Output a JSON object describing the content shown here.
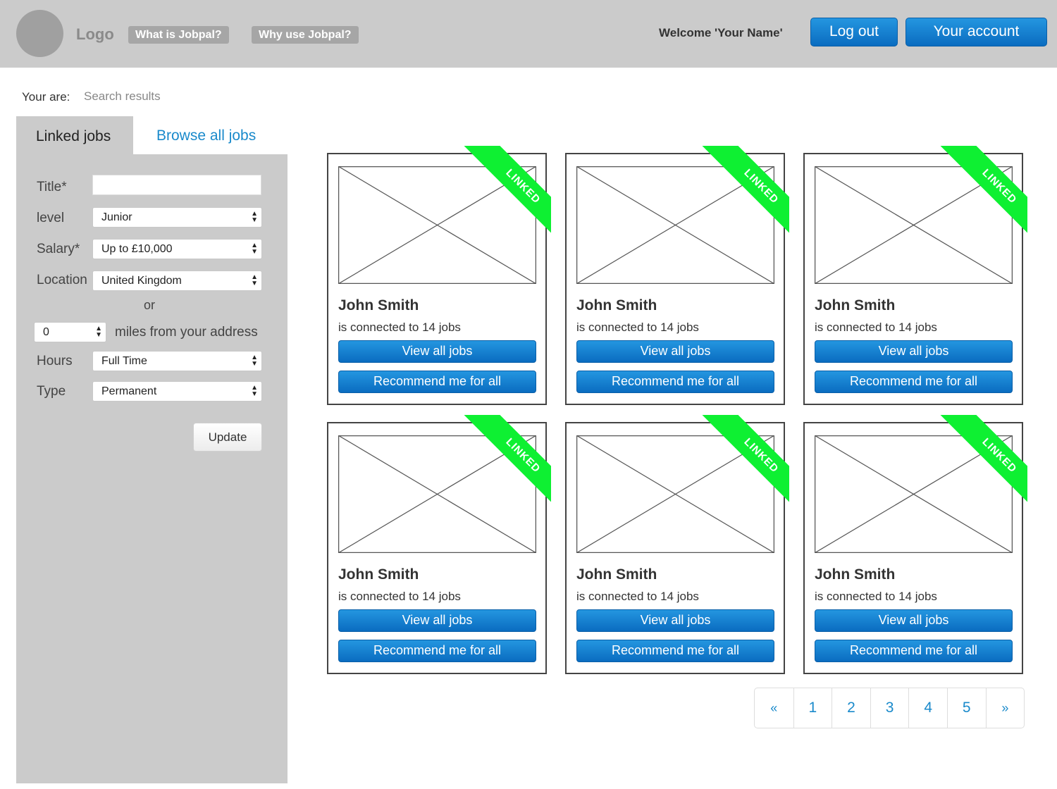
{
  "header": {
    "logo": "Logo",
    "nav": [
      "What is Jobpal?",
      "Why use Jobpal?"
    ],
    "welcome": "Welcome 'Your Name'",
    "logout_label": "Log out",
    "account_label": "Your account"
  },
  "breadcrumb": {
    "label": "Your are:",
    "value": "Search results"
  },
  "tabs": {
    "active": "Linked jobs",
    "other": "Browse all jobs"
  },
  "filters": {
    "title_label": "Title*",
    "title_value": "",
    "level_label": "level",
    "level_value": "Junior",
    "salary_label": "Salary*",
    "salary_value": "Up to £10,000",
    "location_label": "Location",
    "location_value": "United Kingdom",
    "or_label": "or",
    "miles_value": "0",
    "miles_label": "miles from your address",
    "hours_label": "Hours",
    "hours_value": "Full Time",
    "type_label": "Type",
    "type_value": "Permanent",
    "update_label": "Update"
  },
  "cards": [
    {
      "ribbon": "LINKED",
      "name": "John Smith",
      "subtitle": "is connected to 14 jobs",
      "view_label": "View all jobs",
      "recommend_label": "Recommend me for all"
    },
    {
      "ribbon": "LINKED",
      "name": "John Smith",
      "subtitle": "is connected to 14 jobs",
      "view_label": "View all jobs",
      "recommend_label": "Recommend me for all"
    },
    {
      "ribbon": "LINKED",
      "name": "John Smith",
      "subtitle": "is connected to 14 jobs",
      "view_label": "View all jobs",
      "recommend_label": "Recommend me for all"
    },
    {
      "ribbon": "LINKED",
      "name": "John Smith",
      "subtitle": "is connected to 14 jobs",
      "view_label": "View all jobs",
      "recommend_label": "Recommend me for all"
    },
    {
      "ribbon": "LINKED",
      "name": "John Smith",
      "subtitle": "is connected to 14 jobs",
      "view_label": "View all jobs",
      "recommend_label": "Recommend me for all"
    },
    {
      "ribbon": "LINKED",
      "name": "John Smith",
      "subtitle": "is connected to 14 jobs",
      "view_label": "View all jobs",
      "recommend_label": "Recommend me for all"
    }
  ],
  "pagination": {
    "prev": "«",
    "pages": [
      "1",
      "2",
      "3",
      "4",
      "5"
    ],
    "next": "»"
  },
  "colors": {
    "accent": "#1a8acb",
    "button": "#1479cf",
    "ribbon": "#0ef032",
    "header": "#cbcbcb"
  }
}
